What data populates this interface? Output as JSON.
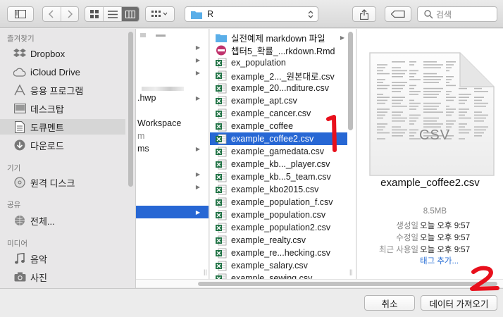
{
  "toolbar": {
    "location": "R",
    "search_placeholder": "검색",
    "icons": [
      "sidebar-toggle-icon",
      "back-icon",
      "forward-icon",
      "icon-view-icon",
      "list-view-icon",
      "column-view-icon",
      "arrange-icon",
      "folder-icon",
      "share-icon",
      "tag-icon",
      "search-icon"
    ]
  },
  "sidebar": {
    "favorites_header": "즐겨찾기",
    "favorites": [
      {
        "label": "Dropbox",
        "icon": "dropbox-icon"
      },
      {
        "label": "iCloud Drive",
        "icon": "cloud-icon"
      },
      {
        "label": "응용 프로그램",
        "icon": "applications-icon"
      },
      {
        "label": "데스크탑",
        "icon": "desktop-icon"
      },
      {
        "label": "도큐멘트",
        "icon": "documents-icon"
      },
      {
        "label": "다운로드",
        "icon": "downloads-icon"
      }
    ],
    "devices_header": "기기",
    "devices": [
      {
        "label": "원격 디스크",
        "icon": "disc-icon"
      }
    ],
    "shared_header": "공유",
    "shared": [
      {
        "label": "전체...",
        "icon": "network-icon"
      }
    ],
    "media_header": "미디어",
    "media": [
      {
        "label": "음악",
        "icon": "music-icon"
      },
      {
        "label": "사진",
        "icon": "camera-icon"
      }
    ]
  },
  "column1": {
    "rows": [
      ".hwp",
      "Workspace",
      "m",
      "ms"
    ]
  },
  "files": [
    {
      "name": "실전예제 markdown 파일",
      "type": "folder"
    },
    {
      "name": "챕터5_확률_...rkdown.Rmd",
      "type": "rmd"
    },
    {
      "name": "ex_population",
      "type": "xls"
    },
    {
      "name": "example_2..._원본대로.csv",
      "type": "xls"
    },
    {
      "name": "example_20...nditure.csv",
      "type": "xls"
    },
    {
      "name": "example_apt.csv",
      "type": "xls"
    },
    {
      "name": "example_cancer.csv",
      "type": "xls"
    },
    {
      "name": "example_coffee",
      "type": "xls"
    },
    {
      "name": "example_coffee2.csv",
      "type": "xls"
    },
    {
      "name": "example_gamedata.csv",
      "type": "xls"
    },
    {
      "name": "example_kb..._player.csv",
      "type": "xls"
    },
    {
      "name": "example_kb...5_team.csv",
      "type": "xls"
    },
    {
      "name": "example_kbo2015.csv",
      "type": "xls"
    },
    {
      "name": "example_population_f.csv",
      "type": "xls"
    },
    {
      "name": "example_population.csv",
      "type": "xls"
    },
    {
      "name": "example_population2.csv",
      "type": "xls"
    },
    {
      "name": "example_realty.csv",
      "type": "xls"
    },
    {
      "name": "example_re...hecking.csv",
      "type": "xls"
    },
    {
      "name": "example_salary.csv",
      "type": "xls"
    },
    {
      "name": "example_sewing.csv",
      "type": "xls"
    }
  ],
  "selected_index": 8,
  "preview": {
    "doc_label": "CSV",
    "name": "example_coffee2.csv",
    "size": "8.5MB",
    "created_label": "생성일",
    "created": "오늘 오후 9:57",
    "modified_label": "수정일",
    "modified": "오늘 오후 9:57",
    "opened_label": "최근 사용일",
    "opened": "오늘 오후 9:57",
    "tags": "태그 추가..."
  },
  "buttons": {
    "cancel": "취소",
    "import": "데이터 가져오기"
  },
  "annotations": {
    "mark1": "1",
    "mark2": "2",
    "color": "#e8101c"
  },
  "colors": {
    "selection": "#2767d4",
    "excel": "#1f7244"
  }
}
